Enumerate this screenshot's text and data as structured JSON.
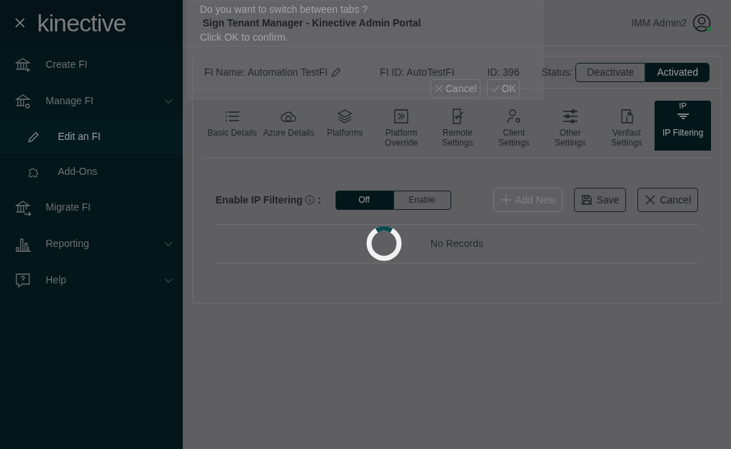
{
  "sidebar": {
    "logo": "kinective",
    "items": [
      {
        "label": "Create FI",
        "has_submenu": false,
        "selected": false
      },
      {
        "label": "Manage FI",
        "has_submenu": true,
        "selected": false,
        "children": [
          {
            "label": "Edit an FI",
            "selected": true
          },
          {
            "label": "Add-Ons",
            "selected": false
          }
        ]
      },
      {
        "label": "Migrate FI",
        "has_submenu": false,
        "selected": false
      },
      {
        "label": "Reporting",
        "has_submenu": true,
        "selected": false
      },
      {
        "label": "Help",
        "has_submenu": true,
        "selected": false
      }
    ]
  },
  "header": {
    "title": "Sign Tenant Manager - Kinective Admin Portal",
    "user": "IMM Admin2",
    "online": true
  },
  "dialog": {
    "lines": [
      "Do you want to switch between tabs ?",
      "Click OK to confirm."
    ],
    "buttons": [
      {
        "label": "Cancel",
        "kind": "cancel"
      },
      {
        "label": "OK",
        "kind": "ok"
      }
    ]
  },
  "fi": {
    "name": "FI Name: Automation TestFI",
    "fi_id": "FI ID: AutoTestFI",
    "id": "ID: 396",
    "status_label": "Status:",
    "status_options": [
      {
        "label": "Deactivate",
        "selected": false
      },
      {
        "label": "Activated",
        "selected": true
      }
    ]
  },
  "tabs": [
    {
      "label": "Basic Details",
      "selected": false
    },
    {
      "label": "Azure Details",
      "selected": false
    },
    {
      "label": "Platforms",
      "selected": false
    },
    {
      "label": "Platform Override",
      "selected": false
    },
    {
      "label": "Remote Settings",
      "selected": false
    },
    {
      "label": "Client Settings",
      "selected": false
    },
    {
      "label": "Other Settings",
      "selected": false
    },
    {
      "label": "Verifast Settings",
      "selected": false
    },
    {
      "label": "IP Filtering",
      "icon_text": "IP",
      "selected": true
    }
  ],
  "ip_filter": {
    "label": "Enable IP Filtering",
    "colon": ":",
    "toggle": [
      {
        "label": "Off",
        "selected": true
      },
      {
        "label": "Enable",
        "selected": false
      }
    ],
    "buttons": [
      {
        "label": "Add New",
        "kind": "add",
        "disabled": true
      },
      {
        "label": "Save",
        "kind": "save",
        "disabled": false
      },
      {
        "label": "Cancel",
        "kind": "cancel",
        "disabled": false
      }
    ]
  },
  "table": {
    "empty_text": "No Records",
    "loading": true
  }
}
